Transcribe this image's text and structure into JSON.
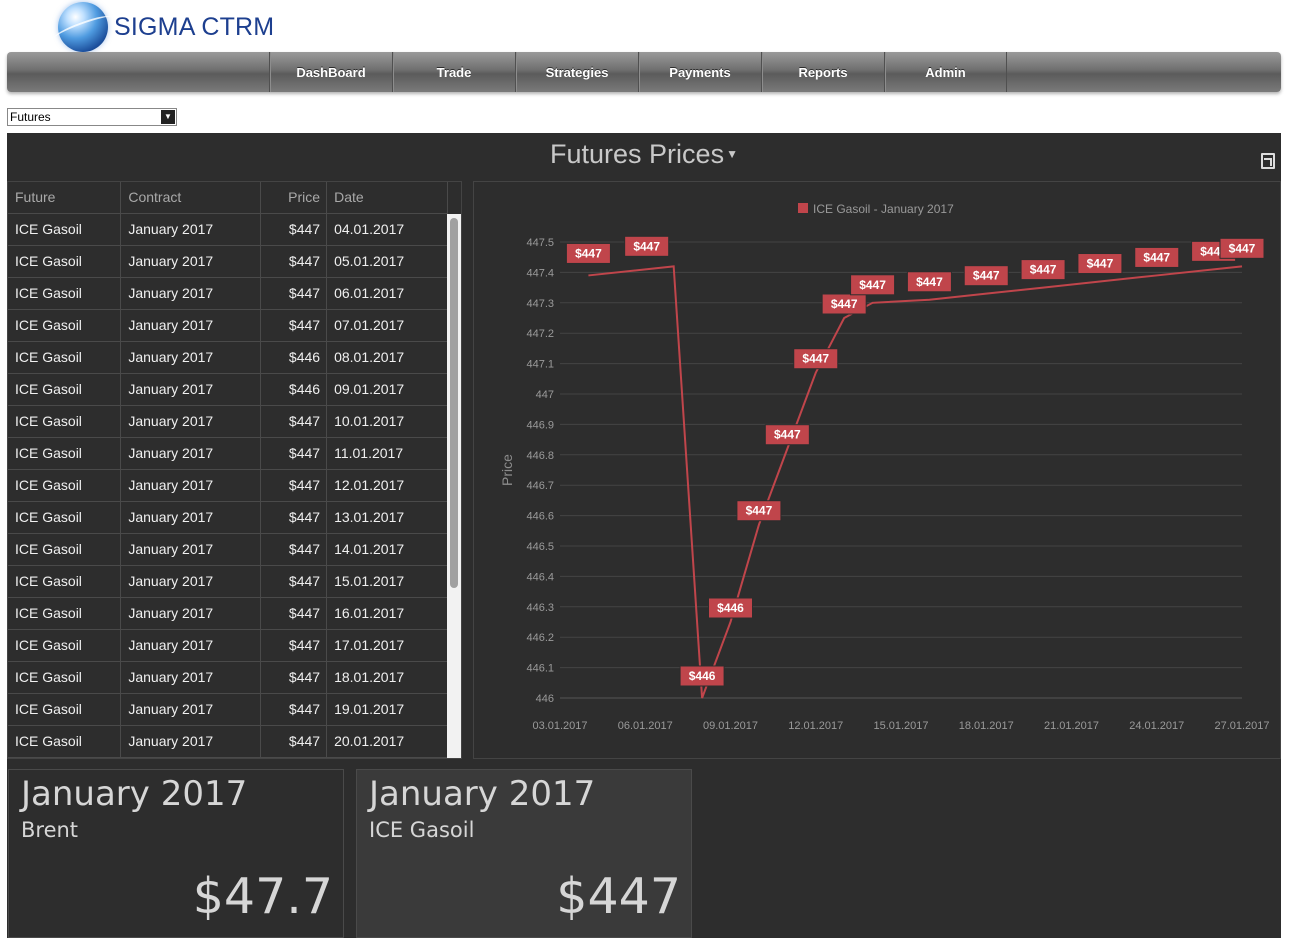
{
  "brand": {
    "name": "SIGMA CTRM"
  },
  "nav": {
    "items": [
      "DashBoard",
      "Trade",
      "Strategies",
      "Payments",
      "Reports",
      "Admin"
    ]
  },
  "selector": {
    "value": "Futures"
  },
  "panel": {
    "title": "Futures Prices"
  },
  "table": {
    "headers": [
      "Future",
      "Contract",
      "Price",
      "Date"
    ],
    "rows": [
      [
        "ICE Gasoil",
        "January 2017",
        "$447",
        "04.01.2017"
      ],
      [
        "ICE Gasoil",
        "January 2017",
        "$447",
        "05.01.2017"
      ],
      [
        "ICE Gasoil",
        "January 2017",
        "$447",
        "06.01.2017"
      ],
      [
        "ICE Gasoil",
        "January 2017",
        "$447",
        "07.01.2017"
      ],
      [
        "ICE Gasoil",
        "January 2017",
        "$446",
        "08.01.2017"
      ],
      [
        "ICE Gasoil",
        "January 2017",
        "$446",
        "09.01.2017"
      ],
      [
        "ICE Gasoil",
        "January 2017",
        "$447",
        "10.01.2017"
      ],
      [
        "ICE Gasoil",
        "January 2017",
        "$447",
        "11.01.2017"
      ],
      [
        "ICE Gasoil",
        "January 2017",
        "$447",
        "12.01.2017"
      ],
      [
        "ICE Gasoil",
        "January 2017",
        "$447",
        "13.01.2017"
      ],
      [
        "ICE Gasoil",
        "January 2017",
        "$447",
        "14.01.2017"
      ],
      [
        "ICE Gasoil",
        "January 2017",
        "$447",
        "15.01.2017"
      ],
      [
        "ICE Gasoil",
        "January 2017",
        "$447",
        "16.01.2017"
      ],
      [
        "ICE Gasoil",
        "January 2017",
        "$447",
        "17.01.2017"
      ],
      [
        "ICE Gasoil",
        "January 2017",
        "$447",
        "18.01.2017"
      ],
      [
        "ICE Gasoil",
        "January 2017",
        "$447",
        "19.01.2017"
      ],
      [
        "ICE Gasoil",
        "January 2017",
        "$447",
        "20.01.2017"
      ]
    ]
  },
  "chart_data": {
    "type": "line",
    "ylabel": "Price",
    "ylim": [
      446,
      447.5
    ],
    "yticks": [
      "447.5",
      "447.4",
      "447.3",
      "447.2",
      "447.1",
      "447",
      "446.9",
      "446.8",
      "446.7",
      "446.6",
      "446.5",
      "446.4",
      "446.3",
      "446.2",
      "446.1",
      "446"
    ],
    "xticks": [
      "03.01.2017",
      "06.01.2017",
      "09.01.2017",
      "12.01.2017",
      "15.01.2017",
      "18.01.2017",
      "21.01.2017",
      "24.01.2017",
      "27.01.2017"
    ],
    "grid": true,
    "legend_position": "top",
    "series": [
      {
        "name": "ICE Gasoil - January 2017",
        "color": "#c0454b",
        "x": [
          "04.01.2017",
          "07.01.2017",
          "08.01.2017",
          "09.01.2017",
          "10.01.2017",
          "11.01.2017",
          "12.01.2017",
          "13.01.2017",
          "14.01.2017",
          "16.01.2017",
          "18.01.2017",
          "20.01.2017",
          "22.01.2017",
          "24.01.2017",
          "26.01.2017",
          "27.01.2017"
        ],
        "values": [
          447.39,
          447.42,
          446,
          446.25,
          446.57,
          446.82,
          447.07,
          447.25,
          447.3,
          447.31,
          447.33,
          447.35,
          447.37,
          447.39,
          447.41,
          447.42
        ],
        "labels": [
          "$447",
          "$447",
          "$446",
          "$446",
          "$447",
          "$447",
          "$447",
          "$447",
          "$447",
          "$447",
          "$447",
          "$447",
          "$447",
          "$447",
          "$447",
          "$447"
        ]
      }
    ]
  },
  "cards": [
    {
      "title": "January 2017",
      "sub": "Brent",
      "value": "$47.7"
    },
    {
      "title": "January 2017",
      "sub": "ICE Gasoil",
      "value": "$447"
    }
  ]
}
